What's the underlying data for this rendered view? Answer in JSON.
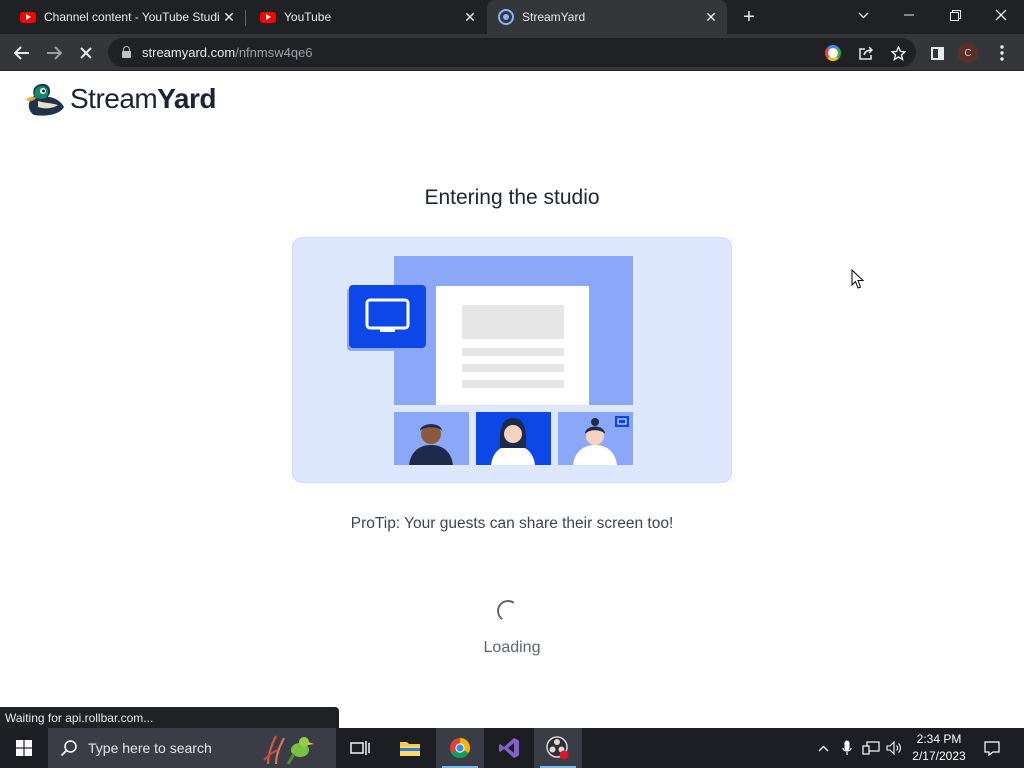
{
  "browser": {
    "tabs": [
      {
        "title": "Channel content - YouTube Studio",
        "icon": "youtube-icon",
        "active": false
      },
      {
        "title": "YouTube",
        "icon": "youtube-icon",
        "active": false
      },
      {
        "title": "StreamYard",
        "icon": "streamyard-icon",
        "active": true
      }
    ],
    "url_host": "streamyard.com",
    "url_path": "/nfnmsw4qe6",
    "profile_initial": "C",
    "status_text": "Waiting for api.rollbar.com..."
  },
  "page": {
    "logo_text_regular": "Stream",
    "logo_text_bold": "Yard",
    "title": "Entering the studio",
    "protip": "ProTip: Your guests can share their screen too!",
    "loading_label": "Loading"
  },
  "taskbar": {
    "search_placeholder": "Type here to search",
    "time": "2:34 PM",
    "date": "2/17/2023",
    "apps": [
      "task-view-icon",
      "file-explorer-icon",
      "chrome-icon",
      "visual-studio-icon",
      "obs-icon"
    ]
  },
  "colors": {
    "tab_strip": "#202124",
    "toolbar": "#35363a",
    "illustration_bg": "#dde8ff",
    "illustration_accent": "#0d47e8",
    "taskbar": "#1c1e24"
  }
}
